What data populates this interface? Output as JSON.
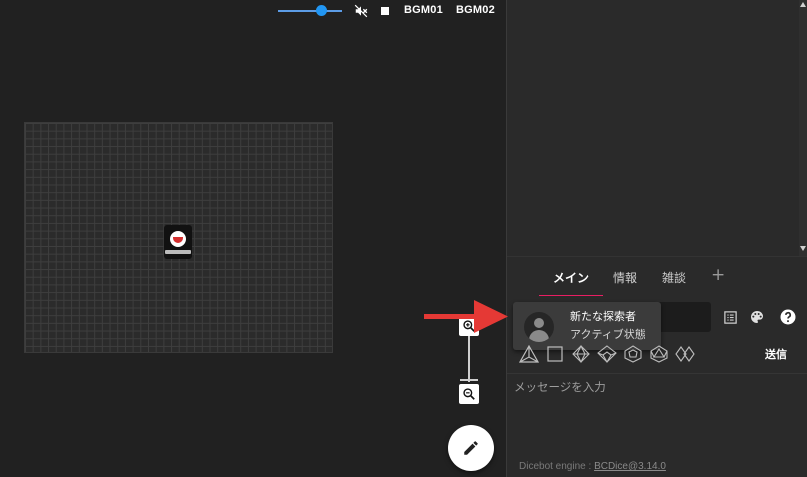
{
  "audio": {
    "volume_percent": 63,
    "bgm_buttons": [
      "BGM01",
      "BGM02"
    ]
  },
  "board": {
    "piece_icon": "character-token"
  },
  "chat": {
    "tabs": [
      {
        "label": "メイン",
        "active": true
      },
      {
        "label": "情報",
        "active": false
      },
      {
        "label": "雑談",
        "active": false
      }
    ],
    "add_tab_label": "+",
    "character_tooltip": {
      "name": "新たな探索者",
      "status": "アクティブ状態"
    },
    "send_label": "送信",
    "message_placeholder": "メッセージを入力",
    "footer_prefix": "Dicebot engine : ",
    "footer_link": "BCDice@3.14.0"
  },
  "colors": {
    "accent": "#e91e63",
    "slider": "#2196f3",
    "arrow": "#e53935"
  }
}
